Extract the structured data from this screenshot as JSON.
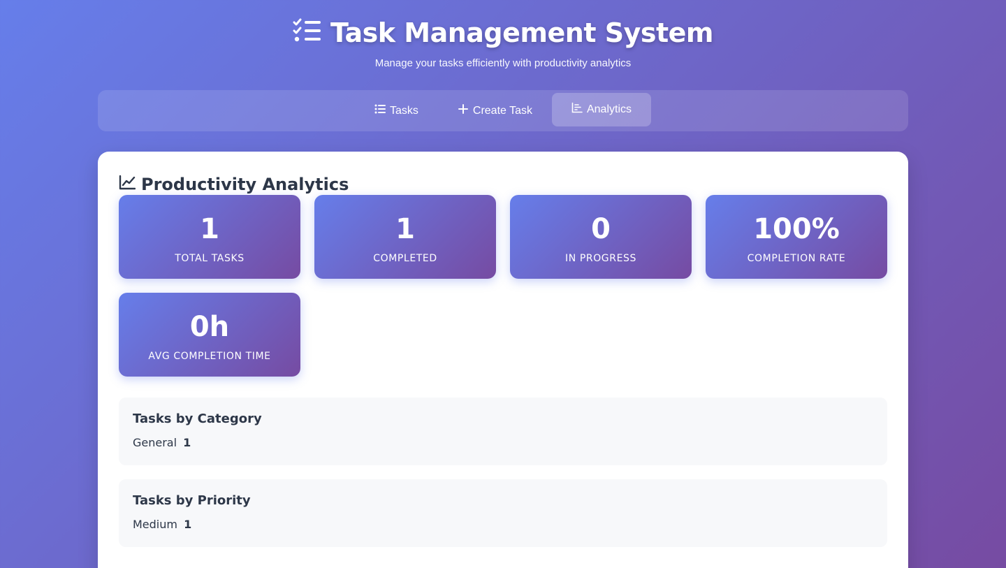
{
  "header": {
    "title": "Task Management System",
    "subtitle": "Manage your tasks efficiently with productivity analytics"
  },
  "nav": {
    "tasks_label": "Tasks",
    "create_label": "Create Task",
    "analytics_label": "Analytics",
    "active": "Analytics"
  },
  "analytics": {
    "title": "Productivity Analytics",
    "stats": [
      {
        "value": "1",
        "label": "Total Tasks"
      },
      {
        "value": "1",
        "label": "Completed"
      },
      {
        "value": "0",
        "label": "In Progress"
      },
      {
        "value": "100%",
        "label": "Completion Rate"
      },
      {
        "value": "0h",
        "label": "Avg Completion Time"
      }
    ],
    "by_category": {
      "title": "Tasks by Category",
      "items": [
        {
          "name": "General",
          "count": "1"
        }
      ]
    },
    "by_priority": {
      "title": "Tasks by Priority",
      "items": [
        {
          "name": "Medium",
          "count": "1"
        }
      ]
    }
  },
  "colors": {
    "gradient_start": "#667eea",
    "gradient_end": "#764ba2",
    "text_dark": "#2d3748"
  }
}
